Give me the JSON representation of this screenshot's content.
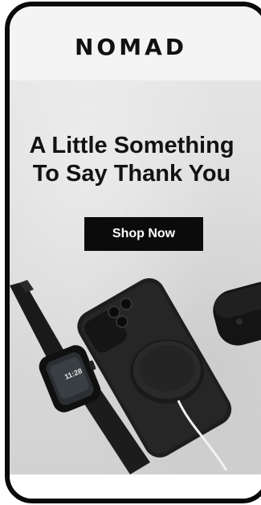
{
  "header": {
    "brand": "NOMAD"
  },
  "hero": {
    "headline_line1": "A Little Something",
    "headline_line2": "To Say Thank You",
    "cta_label": "Shop Now"
  },
  "products": {
    "watch_time": "11:28"
  },
  "colors": {
    "frame": "#0a0a0a",
    "header_bg": "#f4f4f4",
    "hero_bg": "#dcdcdc",
    "button_bg": "#0b0b0b",
    "button_text": "#ffffff"
  }
}
